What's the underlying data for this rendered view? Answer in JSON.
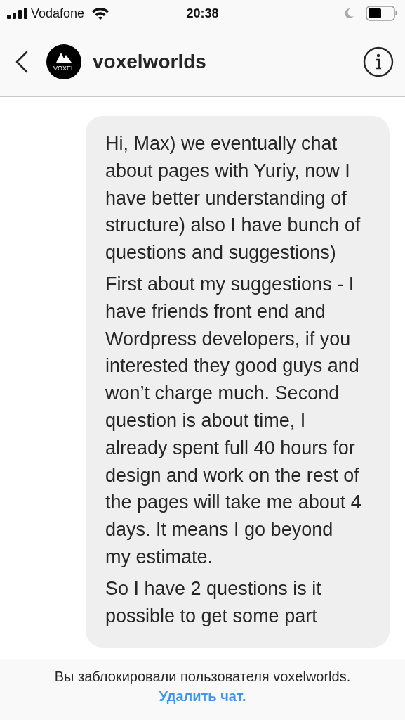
{
  "status_bar": {
    "carrier": "Vodafone",
    "time": "20:38"
  },
  "header": {
    "avatar_label": "VOXEL",
    "username": "voxelworlds"
  },
  "message": {
    "paragraphs": [
      "Hi, Max) we eventually chat about pages with Yuriy, now I have better understanding of structure) also I have bunch of questions and suggestions)",
      "First about my suggestions - I have friends front end and Wordpress developers, if you interested they good guys and won’t charge much. Second question is about time, I already spent full 40 hours for design and work on the rest of the pages will take me about 4 days. It means I go beyond my estimate.",
      "So I have 2 questions is it possible to get some part"
    ]
  },
  "banner": {
    "notice": "Вы заблокировали пользователя voxelworlds.",
    "link": "Удалить чат."
  }
}
